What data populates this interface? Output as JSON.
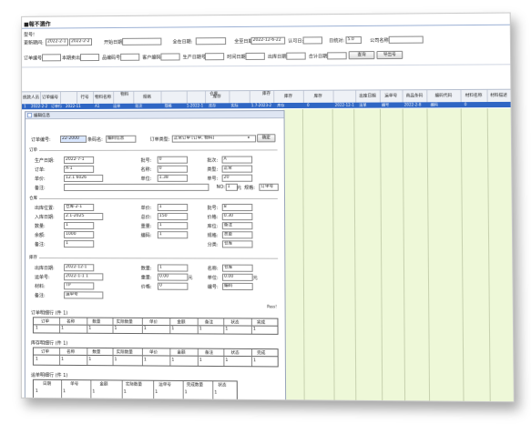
{
  "window": {
    "title": "■報不選作"
  },
  "filters": {
    "row1_label": "型号!",
    "date_label": "更新期间:",
    "date_from": "2022-2-1",
    "date_to": "2022-2-2",
    "f1_label": "开始日期:",
    "f2_label": "全在日期:",
    "f3_label": "全至日期:",
    "f3_value": "2022-12-6-22",
    "f4_label": "认可日:",
    "f5_label": "日统对:",
    "f5_value": "5.0",
    "f6_label": "公司名称:",
    "row2": [
      "订单编号:",
      "本期卖出:",
      "品编码号:",
      "客户编码:",
      "生产日期号:",
      "时间日期:",
      "出库日期:",
      "合计日期:"
    ],
    "query_btn": "查询",
    "export_btn": "导出号"
  },
  "grid": {
    "headers": [
      "统款人员",
      "订单编号",
      "",
      "行号",
      "物料名称",
      "",
      "规格",
      "",
      "",
      "库存",
      "",
      "",
      "库存",
      "库存",
      "",
      "出库日期",
      "运单号",
      "商品条码",
      "编码代码",
      "材料名称",
      "材料描述",
      "文件附件"
    ],
    "group_headers": [
      "物料",
      "仓库",
      "库存"
    ],
    "selected_row": [
      "1",
      "2022-2-2",
      "订单行",
      "2022-11",
      "A1",
      "运单",
      "批次",
      "规格",
      "1-2022-1",
      "库存",
      "实际",
      "1.7-2023-2",
      "库存",
      "0",
      "2022-12-1",
      "运单",
      "编号",
      "2022-2-8",
      "编码",
      "0"
    ]
  },
  "dialog": {
    "title": "编辑信息",
    "top": {
      "no_label": "订单编号:",
      "no_value": "22-2000",
      "name_label": "条码名:",
      "name_value": "编码信息",
      "type_label": "订单类型:",
      "type_value": "正常订单 [订单, 物料]",
      "btn": "确定"
    },
    "sec1": {
      "title": "订单",
      "fields": [
        {
          "label": "生产日期:",
          "value": "2022-7-1"
        },
        {
          "label": "批号:",
          "value": "0"
        },
        {
          "label": "批次:",
          "value": "A"
        },
        {
          "label": "订单:",
          "value": "A-1"
        },
        {
          "label": "名称:",
          "value": "0"
        },
        {
          "label": "类型:",
          "value": "正常"
        },
        {
          "label": "单价:",
          "value": "12.1 6026"
        },
        {
          "label": "单位:",
          "value": "1.38"
        },
        {
          "label": "单号:",
          "value": "20"
        },
        {
          "label": "备注:",
          "value": ""
        }
      ],
      "tail": {
        "label": "NO:",
        "value": "1",
        "unit": "元",
        "label2": "规格:",
        "value2": "订单号"
      }
    },
    "sec2": {
      "title": "仓库",
      "fields": [
        {
          "label": "出库位置:",
          "value": "仓库-2-1"
        },
        {
          "label": "入库日期:",
          "value": "2.1-2025"
        },
        {
          "label": "数量:",
          "value": "1"
        },
        {
          "label": "余额:",
          "value": "1000"
        },
        {
          "label": "单价:",
          "value": "1"
        },
        {
          "label": "编码:",
          "value": "1"
        },
        {
          "label": "总价:",
          "value": "150"
        },
        {
          "label": "重量:",
          "value": "1"
        },
        {
          "label": "批号:",
          "value": "8"
        },
        {
          "label": "价格:",
          "value": "0.30"
        },
        {
          "label": "库位:",
          "value": "备注"
        },
        {
          "label": "规格:",
          "value": "总量"
        },
        {
          "label": "备注:",
          "value": "1"
        },
        {
          "label": "分类:",
          "value": "仓库"
        }
      ]
    },
    "sec3": {
      "title": "库存",
      "fields": [
        {
          "label": "出库日期:",
          "value": "2022-12-1"
        },
        {
          "label": "运单号:",
          "value": "2022-1-1 1"
        },
        {
          "label": "材料:",
          "value": "TP"
        },
        {
          "label": "备注:",
          "value": "运单号"
        },
        {
          "label": "数量:",
          "value": "1"
        },
        {
          "label": "重量:",
          "value": "0.00"
        },
        {
          "label": "价格:",
          "value": "0"
        },
        {
          "label": "名称:",
          "value": "仓库"
        },
        {
          "label": "单位:",
          "value": "0.00"
        },
        {
          "label": "编号:",
          "value": "编码"
        }
      ],
      "unit": "元"
    },
    "table1": {
      "title": "订单明细行 (件 1)",
      "headers": [
        "订单",
        "名称",
        "数量",
        "实际数量",
        "单价",
        "金额",
        "备注",
        "状态",
        "完成"
      ],
      "row": [
        "1",
        "1",
        "1",
        "1",
        "1",
        "1",
        "1",
        "1",
        "1"
      ]
    },
    "table2": {
      "title": "库存明细行 (件 1)",
      "headers": [
        "订单",
        "名称",
        "数量",
        "实际数量",
        "单价",
        "金额",
        "备注",
        "状态",
        "完成"
      ],
      "row": [
        "1",
        "1",
        "1",
        "1",
        "1",
        "1",
        "1",
        "1",
        "1"
      ]
    },
    "table3": {
      "title": "运单明细行 (件 1)",
      "headers": [
        "日期",
        "单号",
        "金额",
        "实际数量",
        "运单号",
        "完成数量",
        "状态"
      ],
      "row": [
        "1",
        "1",
        "1",
        "1",
        "1",
        "1",
        "1"
      ]
    },
    "footer_label": "Pass!"
  },
  "colors": {
    "selection": "#2f66c4",
    "grid_bg": "#eef8d8",
    "header_bg": "#eef1f6"
  }
}
